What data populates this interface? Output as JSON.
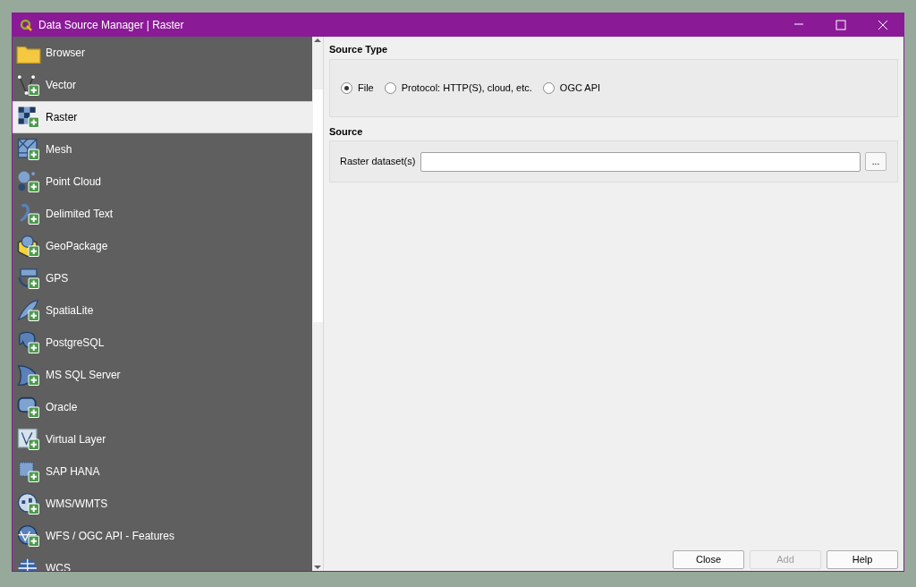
{
  "window": {
    "title": "Data Source Manager | Raster"
  },
  "sidebar": {
    "items": [
      {
        "label": "Browser",
        "selected": false
      },
      {
        "label": "Vector",
        "selected": false
      },
      {
        "label": "Raster",
        "selected": true
      },
      {
        "label": "Mesh",
        "selected": false
      },
      {
        "label": "Point Cloud",
        "selected": false
      },
      {
        "label": "Delimited Text",
        "selected": false
      },
      {
        "label": "GeoPackage",
        "selected": false
      },
      {
        "label": "GPS",
        "selected": false
      },
      {
        "label": "SpatiaLite",
        "selected": false
      },
      {
        "label": "PostgreSQL",
        "selected": false
      },
      {
        "label": "MS SQL Server",
        "selected": false
      },
      {
        "label": "Oracle",
        "selected": false
      },
      {
        "label": "Virtual Layer",
        "selected": false
      },
      {
        "label": "SAP HANA",
        "selected": false
      },
      {
        "label": "WMS/WMTS",
        "selected": false
      },
      {
        "label": "WFS / OGC API - Features",
        "selected": false
      },
      {
        "label": "WCS",
        "selected": false
      }
    ]
  },
  "source_type": {
    "title": "Source Type",
    "options": [
      {
        "label": "File",
        "selected": true
      },
      {
        "label": "Protocol: HTTP(S), cloud, etc.",
        "selected": false
      },
      {
        "label": "OGC API",
        "selected": false
      }
    ]
  },
  "source": {
    "title": "Source",
    "label": "Raster dataset(s)",
    "browse": "..."
  },
  "buttons": [
    {
      "label": "Close",
      "disabled": false
    },
    {
      "label": "Add",
      "disabled": true
    },
    {
      "label": "Help",
      "disabled": false
    }
  ]
}
